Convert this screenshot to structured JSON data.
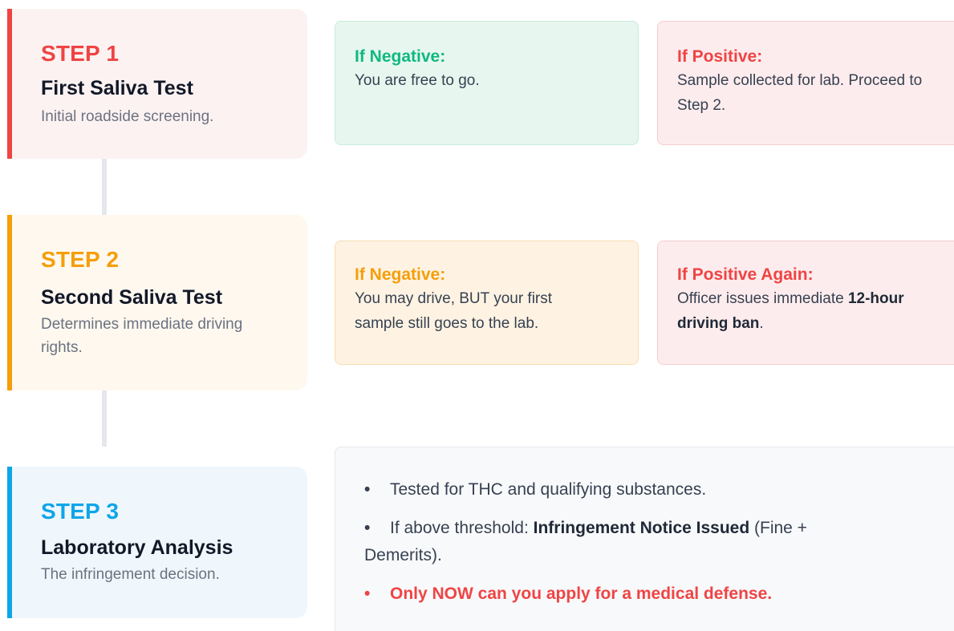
{
  "steps": [
    {
      "number": "STEP 1",
      "title": "First Saliva Test",
      "description": "Initial roadside screening.",
      "color": "#ef4444"
    },
    {
      "number": "STEP 2",
      "title": "Second Saliva Test",
      "description": "Determines immediate driving rights.",
      "color": "#f59e0b"
    },
    {
      "number": "STEP 3",
      "title": "Laboratory Analysis",
      "description": "The infringement decision.",
      "color": "#0ea5e9"
    }
  ],
  "outcomes": {
    "step1_negative": {
      "heading": "If Negative:",
      "body": "You are free to go."
    },
    "step1_positive": {
      "heading": "If Positive:",
      "body": "Sample collected for lab. Proceed to Step 2."
    },
    "step2_negative": {
      "heading": "If Negative:",
      "body": "You may drive, BUT your first sample still goes to the lab."
    },
    "step2_positive": {
      "heading": "If Positive Again:",
      "body_before": "Officer issues immediate ",
      "body_bold": "12-hour driving ban",
      "body_after": "."
    }
  },
  "lab": {
    "bullet": "•",
    "item1": "Tested for THC and qualifying substances.",
    "item2_before": "If above threshold: ",
    "item2_bold": "Infringement Notice Issued",
    "item2_after": " (Fine + Demerits).",
    "item3": "Only NOW can you apply for a medical defense."
  },
  "colors": {
    "negative_green": "#10b981",
    "positive_red": "#ef4444",
    "caution_amber": "#f59e0b",
    "lab_blue": "#0ea5e9"
  }
}
